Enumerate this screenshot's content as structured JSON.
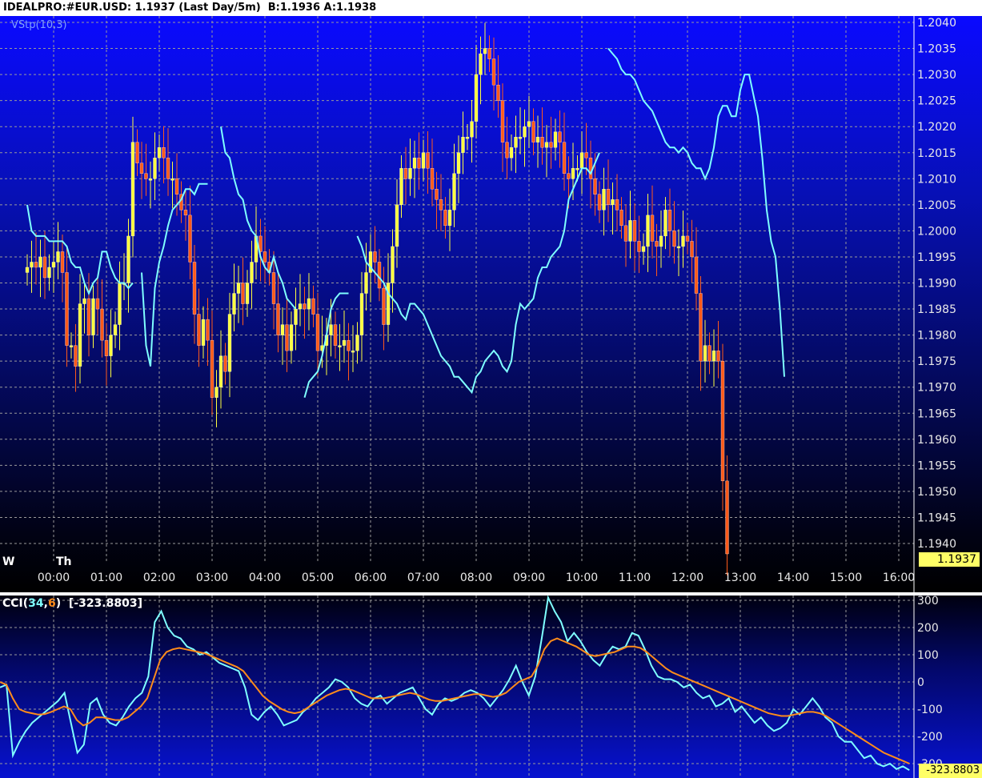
{
  "header": {
    "title": "IDEALPRO:#EUR.USD: 1.1937 (Last Day/5m)  B:1.1936 A:1.1938"
  },
  "price_pane": {
    "indicator_label": "VStp(10,3)",
    "day_labels": [
      "W",
      "Th"
    ],
    "last_price_tag": "1.1937"
  },
  "cci_pane": {
    "label_prefix": "CCI(",
    "label_p1": "34",
    "label_sep": ",",
    "label_p2": "6",
    "label_suffix": ")  [-323.8803]",
    "last_value_tag": "-323.8803"
  },
  "colors": {
    "up_candle": "#ffff40",
    "down_candle": "#ff5a1a",
    "vstop_line": "#7fffff",
    "cci_fast": "#7fffff",
    "cci_slow": "#ff8c1a",
    "grid": "#9a9a9a"
  },
  "chart_data": [
    {
      "type": "candlestick",
      "title": "IDEALPRO:#EUR.USD",
      "xlabel": "",
      "ylabel": "",
      "y_ticks": [
        "1.2040",
        "1.2035",
        "1.2030",
        "1.2025",
        "1.2020",
        "1.2015",
        "1.2010",
        "1.2005",
        "1.2000",
        "1.1995",
        "1.1990",
        "1.1985",
        "1.1980",
        "1.1975",
        "1.1970",
        "1.1965",
        "1.1960",
        "1.1955",
        "1.1950",
        "1.1945",
        "1.1940"
      ],
      "ylim": [
        1.1935,
        1.2041
      ],
      "x_ticks": [
        "00:00",
        "01:00",
        "02:00",
        "03:00",
        "04:00",
        "05:00",
        "06:00",
        "07:00",
        "08:00",
        "09:00",
        "10:00",
        "11:00",
        "12:00",
        "13:00",
        "14:00",
        "15:00",
        "16:00"
      ],
      "grid": true,
      "bar_minutes": 5,
      "x_start": "23:30",
      "close": [
        1.1993,
        1.1994,
        1.1993,
        1.1995,
        1.1991,
        1.1993,
        1.1994,
        1.1996,
        1.1992,
        1.1978,
        1.1978,
        1.1974,
        1.1986,
        1.1987,
        1.198,
        1.1987,
        1.1985,
        1.1979,
        1.1976,
        1.198,
        1.1982,
        1.199,
        1.199,
        1.1999,
        1.2017,
        1.2013,
        1.2011,
        1.201,
        1.201,
        1.2014,
        1.2016,
        1.2014,
        1.201,
        1.201,
        1.2007,
        1.2004,
        1.2003,
        1.1994,
        1.1984,
        1.1978,
        1.1983,
        1.1979,
        1.1968,
        1.197,
        1.1976,
        1.1973,
        1.1984,
        1.1988,
        1.199,
        1.1986,
        1.199,
        1.1994,
        1.1999,
        1.1996,
        1.1994,
        1.1992,
        1.1986,
        1.198,
        1.1982,
        1.1977,
        1.1982,
        1.1985,
        1.1986,
        1.1985,
        1.1987,
        1.1984,
        1.1977,
        1.1978,
        1.198,
        1.1982,
        1.1978,
        1.1978,
        1.1979,
        1.1977,
        1.1977,
        1.198,
        1.1988,
        1.1992,
        1.1996,
        1.1994,
        1.1989,
        1.1982,
        1.199,
        1.1997,
        1.2005,
        1.2012,
        1.201,
        1.2012,
        1.2014,
        1.2012,
        1.2015,
        1.2012,
        1.2008,
        1.2006,
        1.2004,
        1.2001,
        1.2004,
        1.2011,
        1.2015,
        1.2018,
        1.2018,
        1.2021,
        1.203,
        1.2034,
        1.2035,
        1.2033,
        1.2028,
        1.2025,
        1.2017,
        1.2014,
        1.2016,
        1.2018,
        1.2018,
        1.202,
        1.2021,
        1.2017,
        1.2018,
        1.2016,
        1.2017,
        1.2016,
        1.2019,
        1.2017,
        1.2011,
        1.201,
        1.2012,
        1.2012,
        1.2015,
        1.2014,
        1.201,
        1.2007,
        1.2004,
        1.2008,
        1.2005,
        1.2006,
        1.2004,
        1.2001,
        1.1998,
        1.2002,
        1.1998,
        1.1996,
        1.1997,
        1.2003,
        1.1998,
        1.1997,
        1.1999,
        1.2004,
        1.2,
        1.1997,
        1.1997,
        1.1999,
        1.1998,
        1.1995,
        1.1988,
        1.1975,
        1.1978,
        1.1975,
        1.1977,
        1.1975,
        1.1952,
        1.1938
      ],
      "vstop": [
        1.2005,
        1.2,
        1.1999,
        1.1999,
        1.1999,
        1.1998,
        1.1998,
        1.1998,
        1.1998,
        1.1997,
        1.1994,
        1.1993,
        1.1993,
        1.199,
        1.1988,
        1.199,
        1.1991,
        1.1996,
        1.1996,
        1.1993,
        1.1991,
        1.199,
        1.199,
        1.1989,
        1.199,
        null,
        1.1992,
        1.1978,
        1.1974,
        1.1989,
        1.1994,
        1.1997,
        1.2001,
        1.2004,
        1.2005,
        1.2006,
        1.2008,
        1.2008,
        1.2007,
        1.2009,
        1.2009,
        1.2009,
        null,
        null,
        1.202,
        1.2015,
        1.2014,
        1.201,
        1.2007,
        1.2006,
        1.2002,
        1.2,
        1.1999,
        1.1995,
        1.1993,
        1.1992,
        1.1995,
        1.1992,
        1.199,
        1.1987,
        1.1986,
        1.1985,
        null,
        1.1968,
        1.1971,
        1.1972,
        1.1973,
        1.1976,
        1.198,
        1.1985,
        1.1987,
        1.1988,
        1.1988,
        1.1988,
        null,
        1.1999,
        1.1997,
        1.1994,
        1.1993,
        1.1992,
        1.1991,
        1.199,
        1.1988,
        1.1987,
        1.1986,
        1.1984,
        1.1983,
        1.1986,
        1.1986,
        1.1985,
        1.1984,
        1.1982,
        1.198,
        1.1978,
        1.1976,
        1.1975,
        1.1974,
        1.1972,
        1.1972,
        1.1971,
        1.197,
        1.1969,
        1.1972,
        1.1973,
        1.1975,
        1.1976,
        1.1977,
        1.1976,
        1.1974,
        1.1973,
        1.1975,
        1.1982,
        1.1986,
        1.1985,
        1.1986,
        1.1987,
        1.1991,
        1.1993,
        1.1993,
        1.1995,
        1.1996,
        1.1997,
        1.2,
        1.2006,
        1.2008,
        1.201,
        1.2012,
        1.2012,
        1.2011,
        1.2013,
        1.2015,
        null,
        1.2035,
        1.2034,
        1.2033,
        1.2031,
        1.203,
        1.203,
        1.2029,
        1.2027,
        1.2025,
        1.2024,
        1.2023,
        1.2021,
        1.2019,
        1.2017,
        1.2016,
        1.2016,
        1.2015,
        1.2016,
        1.2015,
        1.2013,
        1.2012,
        1.2012,
        1.201,
        1.2012,
        1.2016,
        1.2022,
        1.2024,
        1.2024,
        1.2022,
        1.2022,
        1.2027,
        1.203,
        1.203,
        1.2026,
        1.2022,
        1.2014,
        1.2004,
        1.1998,
        1.1995,
        1.1985,
        1.1972
      ]
    },
    {
      "type": "line",
      "title": "CCI(34,6)  [-323.8803]",
      "xlabel": "",
      "ylabel": "",
      "y_ticks": [
        "300",
        "200",
        "100",
        "0",
        "-100",
        "-200",
        "-300"
      ],
      "ylim": [
        -330,
        320
      ],
      "grid": true,
      "series": [
        {
          "name": "34",
          "values": [
            -20,
            -10,
            -270,
            -220,
            -180,
            -150,
            -130,
            -110,
            -90,
            -70,
            -40,
            -150,
            -260,
            -230,
            -80,
            -60,
            -120,
            -150,
            -160,
            -130,
            -90,
            -60,
            -40,
            20,
            220,
            260,
            200,
            170,
            160,
            130,
            120,
            100,
            110,
            90,
            70,
            60,
            50,
            40,
            -20,
            -120,
            -140,
            -110,
            -90,
            -120,
            -160,
            -150,
            -140,
            -110,
            -90,
            -60,
            -40,
            -20,
            10,
            0,
            -20,
            -60,
            -80,
            -90,
            -60,
            -50,
            -80,
            -60,
            -40,
            -30,
            -20,
            -60,
            -100,
            -120,
            -80,
            -60,
            -70,
            -60,
            -40,
            -30,
            -40,
            -60,
            -90,
            -60,
            -30,
            10,
            60,
            0,
            -50,
            20,
            160,
            310,
            260,
            220,
            150,
            180,
            150,
            110,
            80,
            60,
            100,
            130,
            120,
            130,
            180,
            170,
            120,
            60,
            20,
            10,
            10,
            0,
            -20,
            -10,
            -40,
            -60,
            -50,
            -90,
            -80,
            -60,
            -110,
            -90,
            -120,
            -150,
            -130,
            -160,
            -180,
            -170,
            -150,
            -100,
            -120,
            -90,
            -60,
            -90,
            -130,
            -150,
            -200,
            -220,
            -220,
            -250,
            -280,
            -270,
            -300,
            -310,
            -300,
            -320,
            -310,
            -324
          ]
        },
        {
          "name": "6",
          "values": [
            0,
            -10,
            -60,
            -100,
            -110,
            -115,
            -120,
            -118,
            -110,
            -100,
            -90,
            -100,
            -140,
            -160,
            -150,
            -130,
            -130,
            -135,
            -140,
            -140,
            -130,
            -110,
            -90,
            -60,
            10,
            80,
            110,
            120,
            125,
            120,
            115,
            110,
            105,
            95,
            85,
            75,
            65,
            55,
            40,
            10,
            -20,
            -50,
            -70,
            -85,
            -100,
            -110,
            -115,
            -110,
            -95,
            -80,
            -65,
            -50,
            -40,
            -30,
            -25,
            -30,
            -40,
            -50,
            -60,
            -60,
            -60,
            -55,
            -50,
            -45,
            -40,
            -45,
            -55,
            -65,
            -70,
            -70,
            -65,
            -60,
            -55,
            -50,
            -45,
            -45,
            -50,
            -55,
            -50,
            -40,
            -20,
            0,
            10,
            20,
            60,
            120,
            150,
            160,
            150,
            140,
            130,
            115,
            100,
            95,
            100,
            105,
            110,
            120,
            130,
            130,
            125,
            110,
            90,
            70,
            50,
            35,
            25,
            15,
            5,
            -5,
            -15,
            -25,
            -35,
            -45,
            -55,
            -65,
            -75,
            -85,
            -95,
            -105,
            -115,
            -120,
            -125,
            -125,
            -120,
            -115,
            -110,
            -110,
            -115,
            -125,
            -140,
            -155,
            -170,
            -185,
            -200,
            -215,
            -230,
            -245,
            -260,
            -270,
            -280,
            -290,
            -300
          ]
        }
      ]
    }
  ]
}
